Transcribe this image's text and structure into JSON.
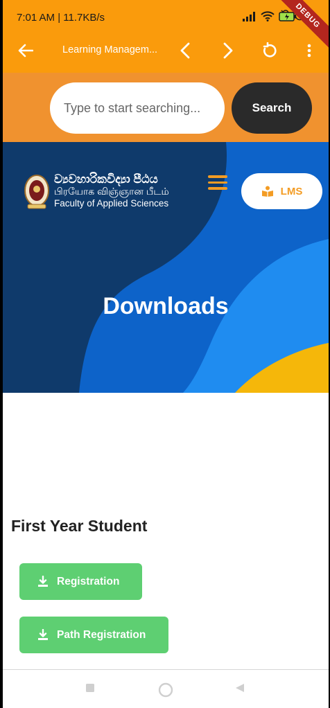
{
  "status_bar": {
    "time_speed": "7:01 AM | 11.7KB/s",
    "debug_label": "DEBUG"
  },
  "app_bar": {
    "title": "Learning Managem...",
    "icons": [
      "back-arrow-icon",
      "chevron-left-icon",
      "chevron-right-icon",
      "refresh-icon",
      "more-vert-icon"
    ]
  },
  "search": {
    "placeholder": "Type to start searching...",
    "button_label": "Search"
  },
  "hero": {
    "logo_line1": "ව්‍යවහාරිකවිද්‍යා පීඨය",
    "logo_line2": "பிரயோக விஞ்ஞான பீடம்",
    "logo_line3": "Faculty of Applied Sciences",
    "lms_label": "LMS",
    "title": "Downloads"
  },
  "content": {
    "section_title": "First Year Student",
    "buttons": [
      {
        "label": "Registration"
      },
      {
        "label": "Path Registration"
      }
    ]
  },
  "colors": {
    "app_bar": "#fa9b0c",
    "search_band": "#f0922f",
    "hero_dark": "#0f3a6b",
    "hero_blue": "#0d63c9",
    "accent_orange": "#f39c24",
    "download_green": "#5ecf72"
  }
}
